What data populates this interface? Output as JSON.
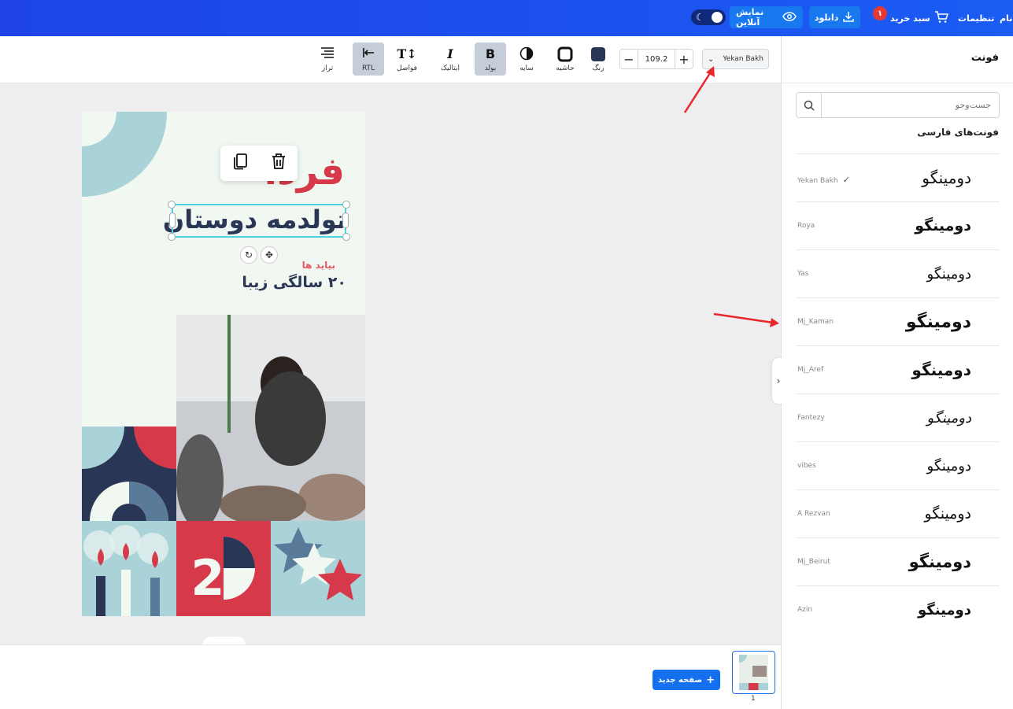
{
  "topbar": {
    "name_item": "نام",
    "settings": "تنظیمات",
    "cart": "سبد خرید",
    "cart_badge": "۱",
    "download": "دانلود",
    "preview": "نمایش آنلاین"
  },
  "toolbar": {
    "align": "تراز",
    "rtl": "RTL",
    "spacing": "فواصل",
    "italic": "ایتالیک",
    "bold": "بولد",
    "shadow": "سایه",
    "border": "حاشیه",
    "color": "رنگ",
    "zoom_value": "109.2",
    "font_selected": "Yekan Bakh",
    "color_swatch": "#2a3655"
  },
  "design": {
    "title_red": "فردا",
    "title_main": "تولدمه دوستان",
    "sub_red": "بیاید ها",
    "sub_main": "۲۰ سالگی زیبا"
  },
  "bottom": {
    "new_page": "صفحه جدید",
    "page_number": "1"
  },
  "panel": {
    "title": "فونت",
    "search_placeholder": "جست‌وجو",
    "section_title": "فونت‌های فارسی",
    "preview_text": "دومینگو",
    "fonts": [
      {
        "name": "Yekan Bakh",
        "selected": true
      },
      {
        "name": "Roya"
      },
      {
        "name": "Yas"
      },
      {
        "name": "Mj_Kaman"
      },
      {
        "name": "Mj_Aref"
      },
      {
        "name": "Fantezy"
      },
      {
        "name": "vibes"
      },
      {
        "name": "A Rezvan"
      },
      {
        "name": "Mj_Beirut"
      },
      {
        "name": "Azin"
      }
    ]
  },
  "colors": {
    "topbar": "#1e44e8",
    "accent_red": "#d63a4a",
    "navy": "#2a3655",
    "teal": "#a9d3d8"
  }
}
